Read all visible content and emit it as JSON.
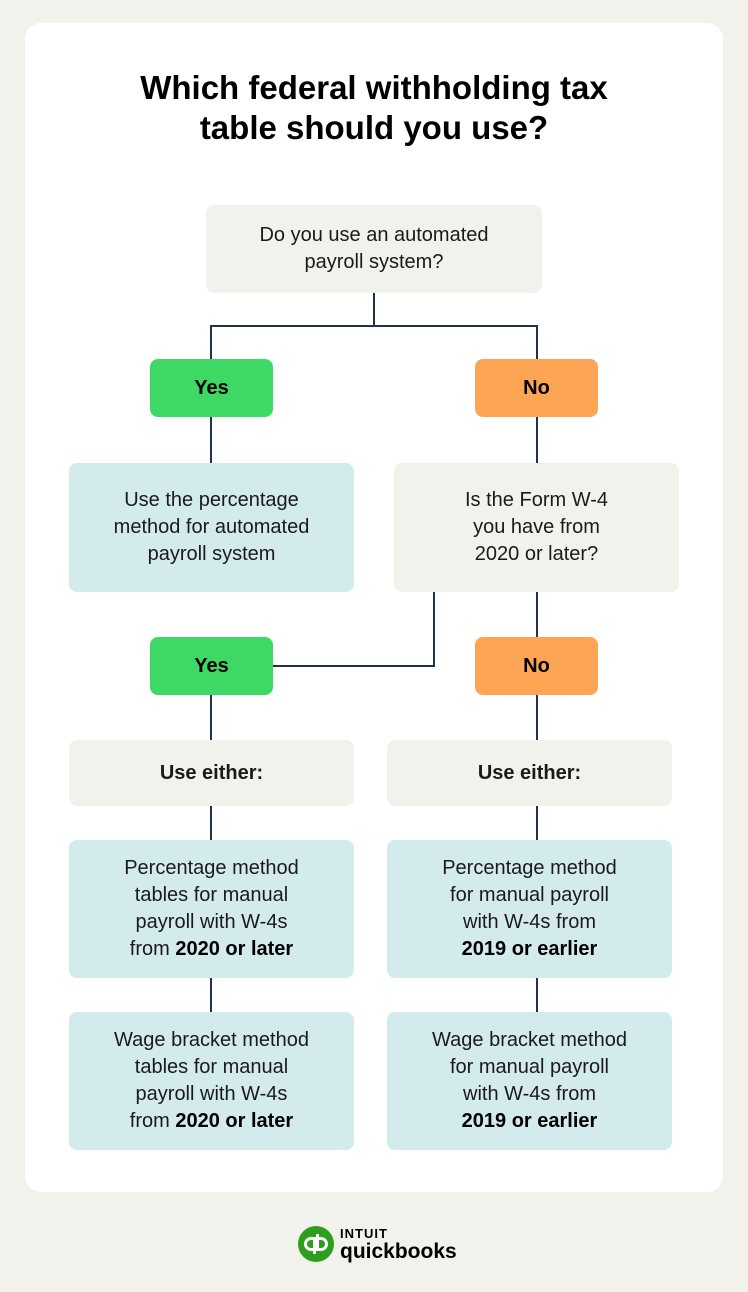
{
  "title_line1": "Which federal withholding tax",
  "title_line2": "table should you use?",
  "colors": {
    "background": "#f2f2ed",
    "card": "#ffffff",
    "question_box": "#f2f2ed",
    "result_box": "#d4ebee",
    "yes": "#3dd964",
    "no": "#fda455",
    "connector": "#1f3350",
    "brand_green": "#2ca01c"
  },
  "nodes": {
    "q1_line1": "Do you use an automated",
    "q1_line2": "payroll system?",
    "yes1": "Yes",
    "no1": "No",
    "result_automated": [
      "Use the percentage",
      "method for automated",
      "payroll system"
    ],
    "q2": [
      "Is the Form W-4",
      "you have from",
      "2020 or later?"
    ],
    "yes2": "Yes",
    "no2": "No",
    "use_either_left": "Use either:",
    "use_either_right": "Use either:",
    "left_pct": {
      "lines": [
        "Percentage method",
        "tables for manual",
        "payroll with W-4s"
      ],
      "prefix": "from ",
      "bold": "2020 or later"
    },
    "left_wage": {
      "lines": [
        "Wage bracket method",
        "tables for manual",
        "payroll with W-4s"
      ],
      "prefix": "from ",
      "bold": "2020 or later"
    },
    "right_pct": {
      "lines": [
        "Percentage method",
        "for manual payroll",
        "with W-4s from"
      ],
      "bold": "2019 or earlier"
    },
    "right_wage": {
      "lines": [
        "Wage bracket method",
        "for manual payroll",
        "with W-4s from"
      ],
      "bold": "2019 or earlier"
    }
  },
  "logo": {
    "icon": "qb-logo-icon",
    "line1": "INTUIT",
    "line2": "quickbooks"
  }
}
